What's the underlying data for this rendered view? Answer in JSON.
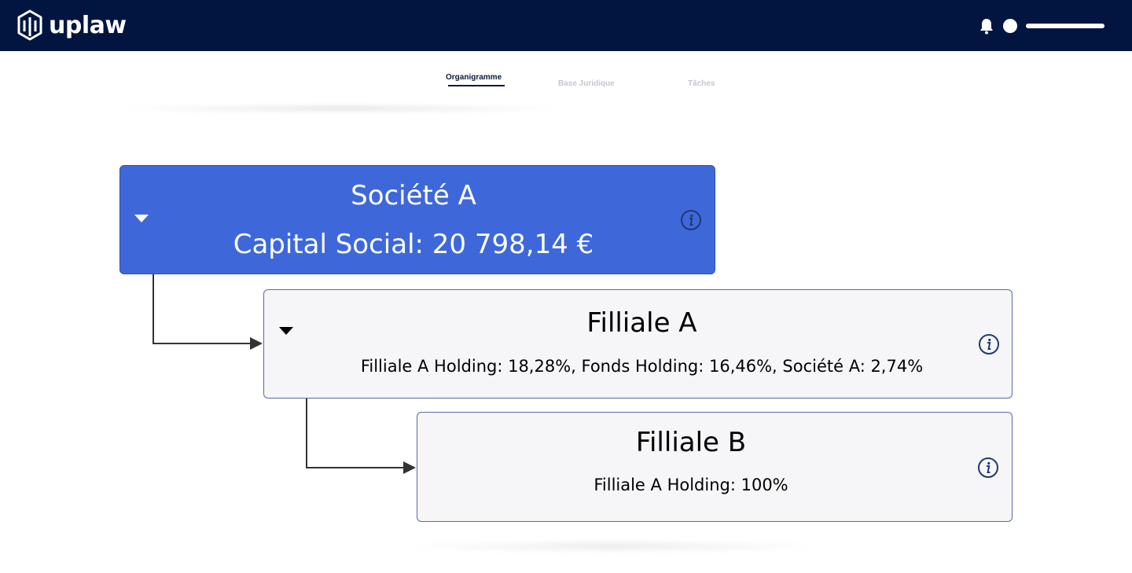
{
  "header": {
    "brand": "uplaw",
    "icons": {
      "logo": "uplaw-logo-icon",
      "bell": "bell-icon",
      "user": "user-avatar-dot"
    },
    "colors": {
      "background": "#011540",
      "foreground": "#ffffff"
    }
  },
  "tabs": [
    {
      "label": "Organigramme",
      "active": true
    },
    {
      "label": "Base Juridique",
      "active": false
    },
    {
      "label": "Tâches",
      "active": false
    }
  ],
  "org": {
    "root": {
      "name": "Société A",
      "detail": "Capital Social: 20 798,14 €",
      "color": "#3e68da",
      "expanded": true
    },
    "children": [
      {
        "name": "Filliale A",
        "detail": "Filliale A Holding: 18,28%, Fonds Holding: 16,46%, Société A: 2,74%",
        "expanded": true
      },
      {
        "name": "Filliale B",
        "detail": "Filliale A Holding: 100%"
      }
    ]
  }
}
